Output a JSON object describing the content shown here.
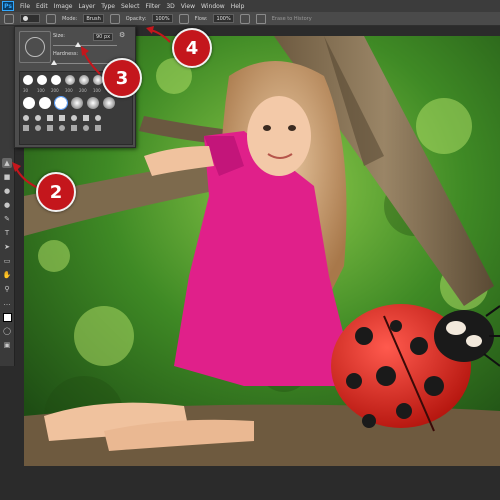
{
  "app": {
    "logo": "Ps"
  },
  "menu": [
    "File",
    "Edit",
    "Image",
    "Layer",
    "Type",
    "Select",
    "Filter",
    "3D",
    "View",
    "Window",
    "Help"
  ],
  "options": {
    "mode_label": "Mode:",
    "mode_value": "Brush",
    "opacity_label": "Opacity:",
    "opacity_value": "100%",
    "flow_label": "Flow:",
    "flow_value": "100%",
    "erase_history": "Erase to History"
  },
  "brush_panel": {
    "size_label": "Size:",
    "size_value": "90 px",
    "hardness_label": "Hardness:",
    "preset_sizes": [
      "30",
      "100",
      "200",
      "300",
      "200",
      "100"
    ]
  },
  "callouts": {
    "c2": "2",
    "c3": "3",
    "c4": "4"
  },
  "colors": {
    "callout": "#c4161c",
    "ps_blue": "#31a8ff"
  }
}
